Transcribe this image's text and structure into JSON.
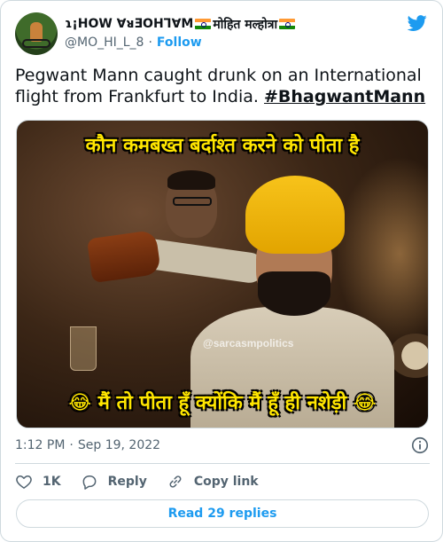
{
  "author": {
    "display_name_flipped": "ɿ¡HOW ∀ᴚƎOHꞀ∀M",
    "display_name_hindi": "मोहित मल्होत्रा",
    "handle": "@MO_HI_L_8",
    "separator": "·",
    "follow_label": "Follow"
  },
  "tweet": {
    "text": "Pegwant Mann caught drunk on an International flight from Frankfurt to India.",
    "hashtag": "#BhagwantMann"
  },
  "media": {
    "top_caption": "कौन कमबख्त बर्दाश्त करने को पीता है",
    "bottom_caption": "😂 मैं तो पीता हूँ क्योंकि मैं हूँ ही नशेड़ी 😂",
    "watermark": "@sarcasmpolitics"
  },
  "meta": {
    "time": "1:12 PM",
    "separator": "·",
    "date": "Sep 19, 2022"
  },
  "actions": {
    "like_count": "1K",
    "reply_label": "Reply",
    "copy_link_label": "Copy link"
  },
  "read_replies_label": "Read 29 replies",
  "colors": {
    "brand_blue": "#1d9bf0",
    "text_primary": "#0f1419",
    "text_secondary": "#536471",
    "border": "#cfd9de",
    "meme_text": "#ffe600"
  },
  "icons": {
    "brand": "twitter-bird-icon",
    "info": "info-icon",
    "like": "heart-icon",
    "reply": "speech-bubble-icon",
    "copy_link": "link-icon"
  }
}
